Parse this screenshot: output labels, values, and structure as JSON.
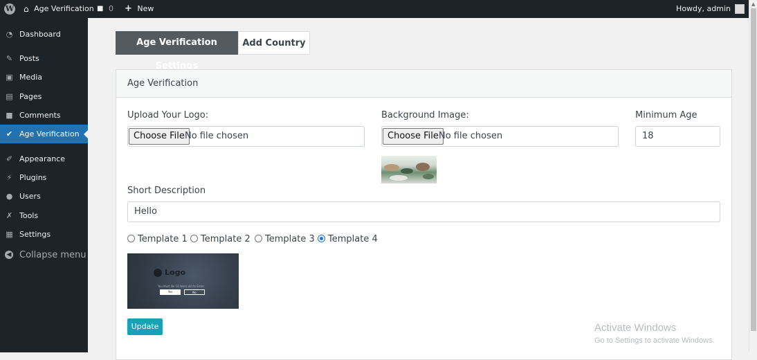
{
  "adminbar": {
    "wp_logo_glyph": "W",
    "site_name": "Age Verification",
    "comments_count": "0",
    "new_label": "New",
    "howdy_text": "Howdy, admin"
  },
  "sidebar": {
    "items": [
      {
        "label": "Dashboard",
        "icon": "dashboard-icon"
      },
      {
        "label": "Posts",
        "icon": "pin-icon"
      },
      {
        "label": "Media",
        "icon": "media-icon"
      },
      {
        "label": "Pages",
        "icon": "pages-icon"
      },
      {
        "label": "Comments",
        "icon": "comment-icon"
      },
      {
        "label": "Age Verification",
        "icon": "check-circle-icon"
      },
      {
        "label": "Appearance",
        "icon": "brush-icon"
      },
      {
        "label": "Plugins",
        "icon": "plugin-icon"
      },
      {
        "label": "Users",
        "icon": "user-icon"
      },
      {
        "label": "Tools",
        "icon": "wrench-icon"
      },
      {
        "label": "Settings",
        "icon": "settings-icon"
      }
    ],
    "collapse_label": "Collapse menu"
  },
  "tabs": {
    "active": "Age Verification Settings",
    "inactive": "Add Country"
  },
  "card": {
    "title": "Age Verification",
    "upload_logo_label": "Upload Your Logo:",
    "background_image_label": "Background Image:",
    "minimum_age_label": "Minimum Age",
    "choose_file_label": "Choose File",
    "no_file_text": "No file chosen",
    "minimum_age_value": "18",
    "short_description_label": "Short Description",
    "short_description_value": "Hello",
    "templates": [
      "Template 1",
      "Template 2",
      "Template 3",
      "Template 4"
    ],
    "selected_template": "Template 4",
    "template_preview": {
      "logo_text": "Logo",
      "question": "You Must Be 18 Years old to Enter",
      "yes": "Yes",
      "no": "No"
    },
    "update_label": "Update"
  },
  "watermark": {
    "title": "Activate Windows",
    "subtitle": "Go to Settings to activate Windows."
  },
  "colors": {
    "adminbar_bg": "#1d2327",
    "current_menu_bg": "#2271b1",
    "active_tab_bg": "#555a5f",
    "update_button_bg": "#17a2b8"
  }
}
